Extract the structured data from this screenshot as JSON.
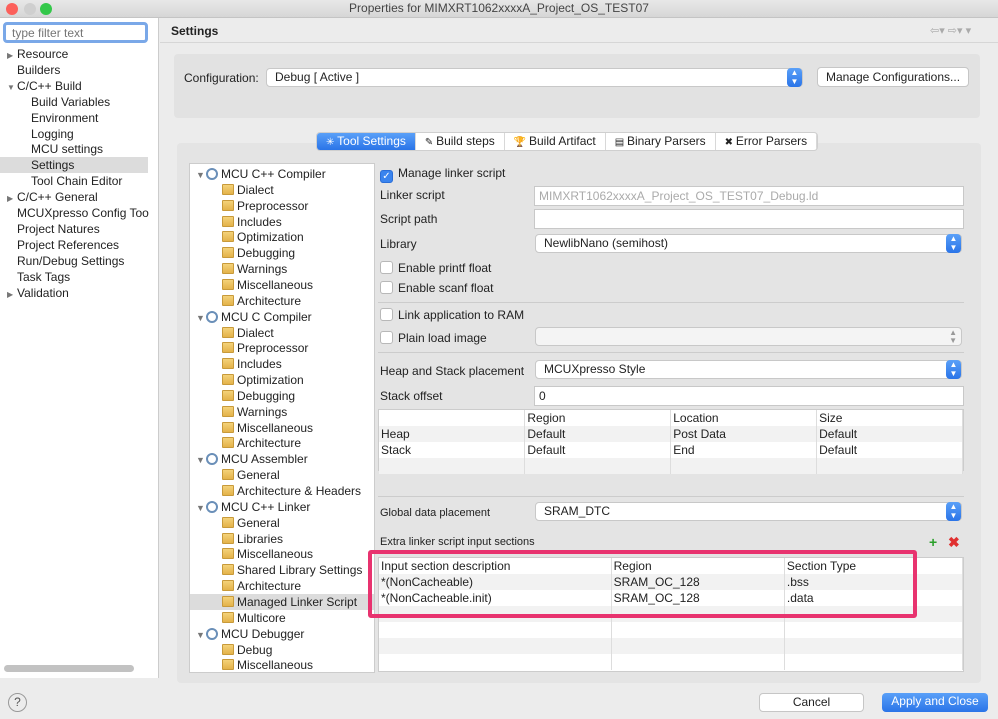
{
  "window": {
    "title": "Properties for MIMXRT1062xxxxA_Project_OS_TEST07"
  },
  "filter": {
    "placeholder": "type filter text"
  },
  "nav": [
    {
      "label": "Resource",
      "indent": 0,
      "arrow": "▶"
    },
    {
      "label": "Builders",
      "indent": 1,
      "arrow": ""
    },
    {
      "label": "C/C++ Build",
      "indent": 0,
      "arrow": "▼"
    },
    {
      "label": "Build Variables",
      "indent": 2,
      "arrow": ""
    },
    {
      "label": "Environment",
      "indent": 2,
      "arrow": ""
    },
    {
      "label": "Logging",
      "indent": 2,
      "arrow": ""
    },
    {
      "label": "MCU settings",
      "indent": 2,
      "arrow": ""
    },
    {
      "label": "Settings",
      "indent": 2,
      "arrow": "",
      "selected": true
    },
    {
      "label": "Tool Chain Editor",
      "indent": 2,
      "arrow": ""
    },
    {
      "label": "C/C++ General",
      "indent": 0,
      "arrow": "▶"
    },
    {
      "label": "MCUXpresso Config Too",
      "indent": 1,
      "arrow": ""
    },
    {
      "label": "Project Natures",
      "indent": 1,
      "arrow": ""
    },
    {
      "label": "Project References",
      "indent": 1,
      "arrow": ""
    },
    {
      "label": "Run/Debug Settings",
      "indent": 1,
      "arrow": ""
    },
    {
      "label": "Task Tags",
      "indent": 1,
      "arrow": ""
    },
    {
      "label": "Validation",
      "indent": 0,
      "arrow": "▶"
    }
  ],
  "header": {
    "title": "Settings"
  },
  "config": {
    "label": "Configuration:",
    "value": "Debug  [ Active ]",
    "manage": "Manage Configurations..."
  },
  "tabs": [
    {
      "label": "Tool Settings",
      "active": true,
      "icon": "✳"
    },
    {
      "label": "Build steps",
      "icon": "✎"
    },
    {
      "label": "Build Artifact",
      "icon": "🏆"
    },
    {
      "label": "Binary Parsers",
      "icon": "▤"
    },
    {
      "label": "Error Parsers",
      "icon": "✖"
    }
  ],
  "tree": [
    {
      "label": "MCU C++ Compiler",
      "level": 0
    },
    {
      "label": "Dialect",
      "level": 1
    },
    {
      "label": "Preprocessor",
      "level": 1
    },
    {
      "label": "Includes",
      "level": 1
    },
    {
      "label": "Optimization",
      "level": 1
    },
    {
      "label": "Debugging",
      "level": 1
    },
    {
      "label": "Warnings",
      "level": 1
    },
    {
      "label": "Miscellaneous",
      "level": 1
    },
    {
      "label": "Architecture",
      "level": 1
    },
    {
      "label": "MCU C Compiler",
      "level": 0
    },
    {
      "label": "Dialect",
      "level": 1
    },
    {
      "label": "Preprocessor",
      "level": 1
    },
    {
      "label": "Includes",
      "level": 1
    },
    {
      "label": "Optimization",
      "level": 1
    },
    {
      "label": "Debugging",
      "level": 1
    },
    {
      "label": "Warnings",
      "level": 1
    },
    {
      "label": "Miscellaneous",
      "level": 1
    },
    {
      "label": "Architecture",
      "level": 1
    },
    {
      "label": "MCU Assembler",
      "level": 0
    },
    {
      "label": "General",
      "level": 1
    },
    {
      "label": "Architecture & Headers",
      "level": 1
    },
    {
      "label": "MCU C++ Linker",
      "level": 0
    },
    {
      "label": "General",
      "level": 1
    },
    {
      "label": "Libraries",
      "level": 1
    },
    {
      "label": "Miscellaneous",
      "level": 1
    },
    {
      "label": "Shared Library Settings",
      "level": 1
    },
    {
      "label": "Architecture",
      "level": 1
    },
    {
      "label": "Managed Linker Script",
      "level": 1,
      "selected": true
    },
    {
      "label": "Multicore",
      "level": 1
    },
    {
      "label": "MCU Debugger",
      "level": 0
    },
    {
      "label": "Debug",
      "level": 1
    },
    {
      "label": "Miscellaneous",
      "level": 1
    }
  ],
  "form": {
    "manage_linker": "Manage linker script",
    "linker_script_label": "Linker script",
    "linker_script_value": "MIMXRT1062xxxxA_Project_OS_TEST07_Debug.ld",
    "script_path_label": "Script path",
    "script_path_value": "",
    "library_label": "Library",
    "library_value": "NewlibNano (semihost)",
    "printf_float": "Enable printf float",
    "scanf_float": "Enable scanf float",
    "link_ram": "Link application to RAM",
    "plain_load": "Plain load image",
    "heap_label": "Heap and Stack placement",
    "heap_value": "MCUXpresso Style",
    "stack_offset_label": "Stack offset",
    "stack_offset_value": "0",
    "hs_table": {
      "headers": [
        "",
        "Region",
        "Location",
        "Size"
      ],
      "rows": [
        [
          "Heap",
          "Default",
          "Post Data",
          "Default"
        ],
        [
          "Stack",
          "Default",
          "End",
          "Default"
        ]
      ]
    },
    "global_label": "Global data placement",
    "global_value": "SRAM_DTC",
    "extra_label": "Extra linker script input sections",
    "extra_table": {
      "headers": [
        "Input section description",
        "Region",
        "Section Type"
      ],
      "rows": [
        [
          "*(NonCacheable)",
          "SRAM_OC_128",
          ".bss"
        ],
        [
          "*(NonCacheable.init)",
          "SRAM_OC_128",
          ".data"
        ]
      ]
    }
  },
  "footer": {
    "cancel": "Cancel",
    "apply": "Apply and Close"
  },
  "colors": {
    "accent": "#2a74e8",
    "highlight": "#e8336f"
  }
}
